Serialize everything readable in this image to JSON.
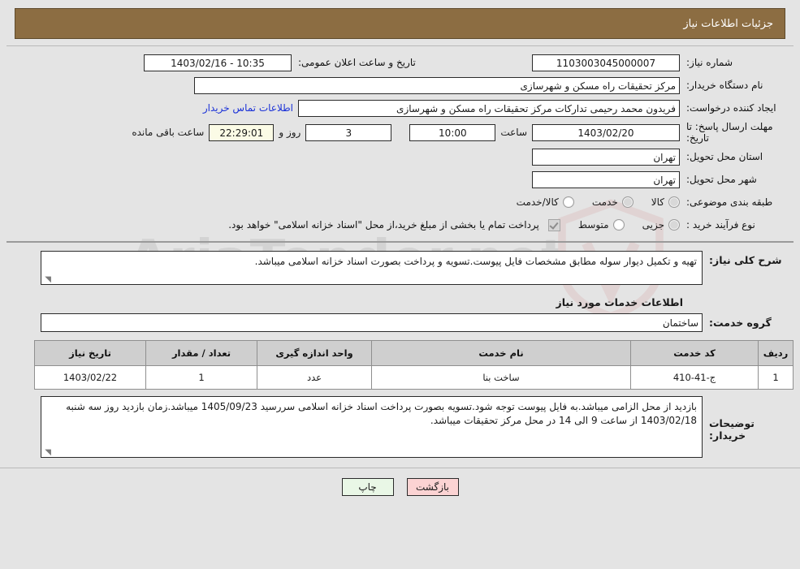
{
  "header": {
    "title": "جزئیات اطلاعات نیاز"
  },
  "watermark": {
    "text": "AriaTender.net"
  },
  "form": {
    "need_number_label": "شماره نیاز:",
    "need_number_value": "1103003045000007",
    "public_announce_label": "تاریخ و ساعت اعلان عمومی:",
    "public_announce_value": "10:35 - 1403/02/16",
    "buyer_org_label": "نام دستگاه خریدار:",
    "buyer_org_value": "مرکز تحقیقات راه  مسکن و شهرسازی",
    "requester_label": "ایجاد کننده درخواست:",
    "requester_value": "فریدون محمد رحیمی تدارکات مرکز تحقیقات راه  مسکن و شهرسازی",
    "contact_link": "اطلاعات تماس خریدار",
    "deadline_label": "مهلت ارسال پاسخ: تا تاریخ:",
    "deadline_date": "1403/02/20",
    "hour_label": "ساعت",
    "hour_value": "10:00",
    "days_value": "3",
    "days_label": "روز و",
    "countdown_value": "22:29:01",
    "countdown_label": "ساعت باقی مانده",
    "province_label": "استان محل تحویل:",
    "province_value": "تهران",
    "city_label": "شهر محل تحویل:",
    "city_value": "تهران",
    "category_label": "طبقه بندی موضوعی:",
    "category_options": [
      "کالا",
      "خدمت",
      "کالا/خدمت"
    ],
    "purchase_type_label": "نوع فرآیند خرید :",
    "purchase_type_options": [
      "جزیی",
      "متوسط"
    ],
    "treasury_note": "پرداخت تمام یا بخشی از مبلغ خرید،از محل \"اسناد خزانه اسلامی\" خواهد بود."
  },
  "description": {
    "label": "شرح کلی نیاز:",
    "value": "تهیه و تکمیل دیوار سوله مطابق مشخصات فایل پیوست.تسویه و پرداخت بصورت اسناد خزانه اسلامی میباشد."
  },
  "services": {
    "section_title": "اطلاعات خدمات مورد نیاز",
    "group_label": "گروه خدمت:",
    "group_value": "ساختمان",
    "columns": [
      "ردیف",
      "کد خدمت",
      "نام خدمت",
      "واحد اندازه گیری",
      "تعداد / مقدار",
      "تاریخ نیاز"
    ],
    "rows": [
      {
        "index": "1",
        "code": "ج-41-410",
        "name": "ساخت بنا",
        "unit": "عدد",
        "quantity": "1",
        "need_date": "1403/02/22"
      }
    ]
  },
  "buyer_notes": {
    "label": "توضیحات خریدار:",
    "value": "بازدید از محل الزامی میباشد.به فایل پیوست توجه شود.تسویه بصورت پرداخت اسناد خزانه اسلامی سررسید 1405/09/23 میباشد.زمان بازدید روز سه شنبه 1403/02/18 از ساعت 9 الی 14 در محل مرکز تحقیقات میباشد."
  },
  "buttons": {
    "print": "چاپ",
    "back": "بازگشت"
  }
}
